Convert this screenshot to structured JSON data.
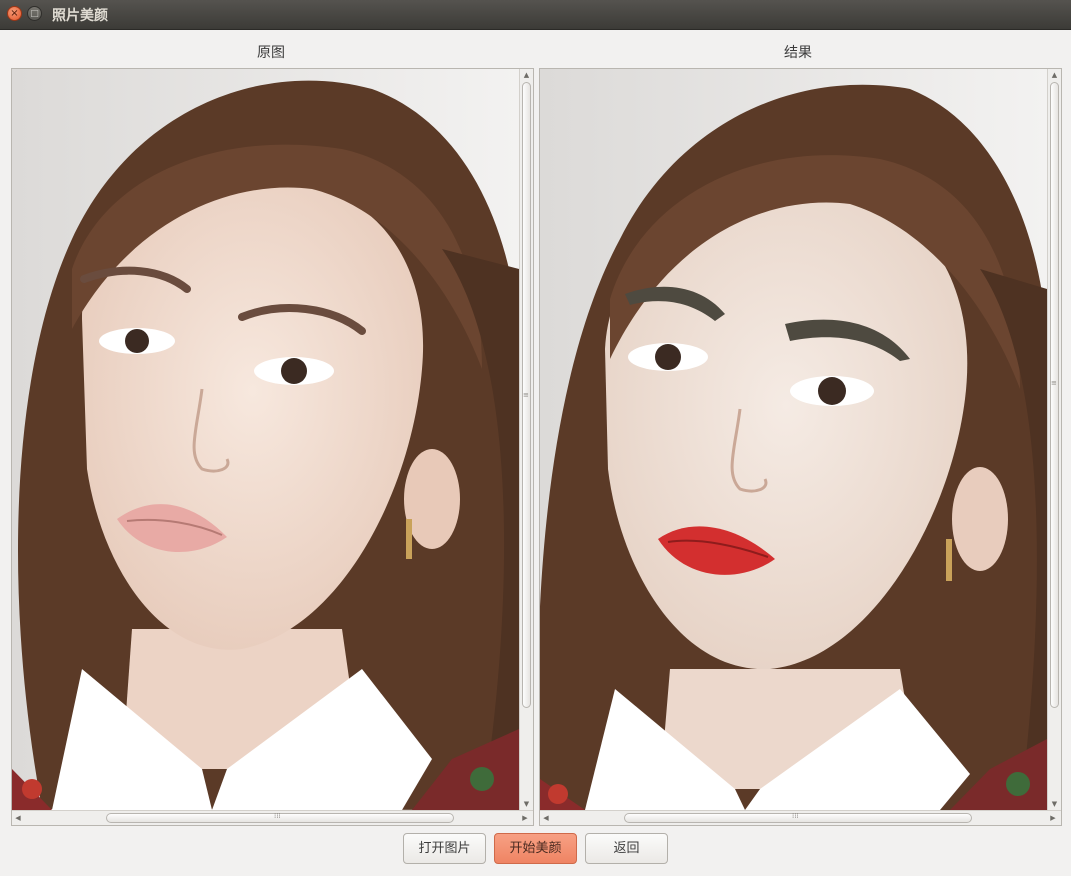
{
  "window": {
    "title": "照片美颜",
    "close_glyph": "×",
    "max_glyph": "□"
  },
  "left_panel": {
    "label": "原图"
  },
  "right_panel": {
    "label": "结果"
  },
  "scroll": {
    "up": "▲",
    "down": "▼",
    "left": "◀",
    "right": "▶",
    "grip_v": "≡",
    "grip_h": "⁞⁞⁞"
  },
  "buttons": {
    "open": "打开图片",
    "beautify": "开始美颜",
    "back": "返回"
  },
  "colors": {
    "accent": "#ef8463",
    "hair": "#5a3a28",
    "skin": "#f0d9cc",
    "lips_original": "#e8aaa5",
    "lips_result": "#d32f2f",
    "eyebrow_result": "#4e4a40"
  }
}
